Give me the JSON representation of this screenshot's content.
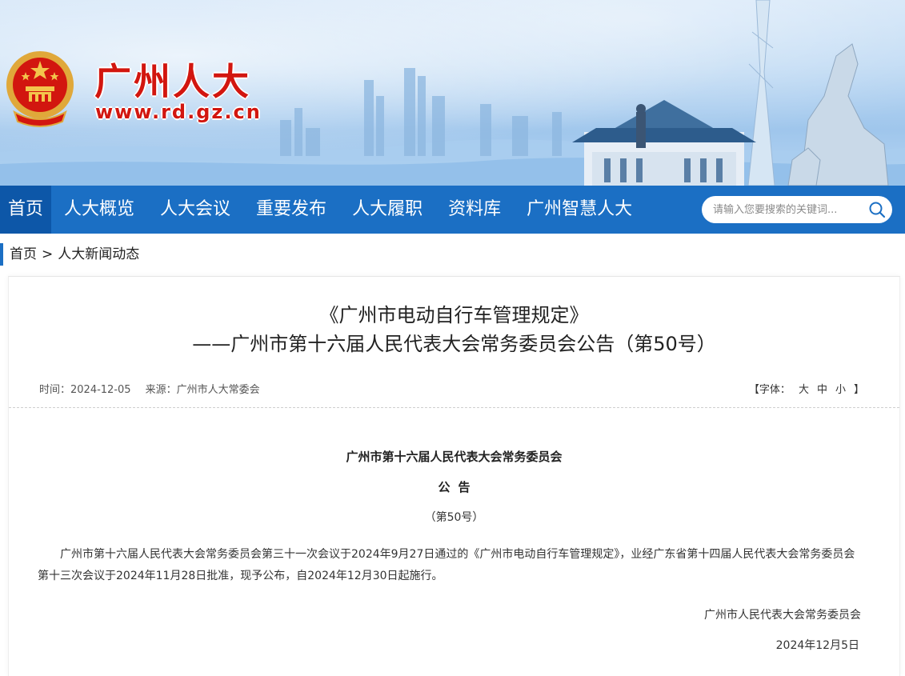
{
  "header": {
    "site_name": "广州人大",
    "site_url": "www.rd.gz.cn"
  },
  "nav": {
    "items": [
      "首页",
      "人大概览",
      "人大会议",
      "重要发布",
      "人大履职",
      "资料库",
      "广州智慧人大"
    ],
    "active_index": 0
  },
  "search": {
    "placeholder": "请输入您要搜索的关键词..."
  },
  "breadcrumb": {
    "home": "首页",
    "separator": ">",
    "current": "人大新闻动态"
  },
  "article": {
    "title_line1": "《广州市电动自行车管理规定》",
    "title_line2": "——广州市第十六届人民代表大会常务委员会公告（第50号）",
    "meta_time_label": "时间：",
    "meta_time": "2024-12-05",
    "meta_source_label": "来源：",
    "meta_source": "广州市人大常委会",
    "fontsize_open": "【字体：",
    "fontsize_large": "大",
    "fontsize_medium": "中",
    "fontsize_small": "小",
    "fontsize_close": "】",
    "heading_org": "广州市第十六届人民代表大会常务委员会",
    "heading_notice": "公告",
    "heading_number": "（第50号）",
    "body": "广州市第十六届人民代表大会常务委员会第三十一次会议于2024年9月27日通过的《广州市电动自行车管理规定》，业经广东省第十四届人民代表大会常务委员会第十三次会议于2024年11月28日批准，现予公布，自2024年12月30日起施行。",
    "signature_org": "广州市人民代表大会常务委员会",
    "signature_date": "2024年12月5日"
  },
  "colors": {
    "brand_red": "#d2160f",
    "nav_blue": "#1b6fc4",
    "nav_active": "#0d57a8"
  }
}
